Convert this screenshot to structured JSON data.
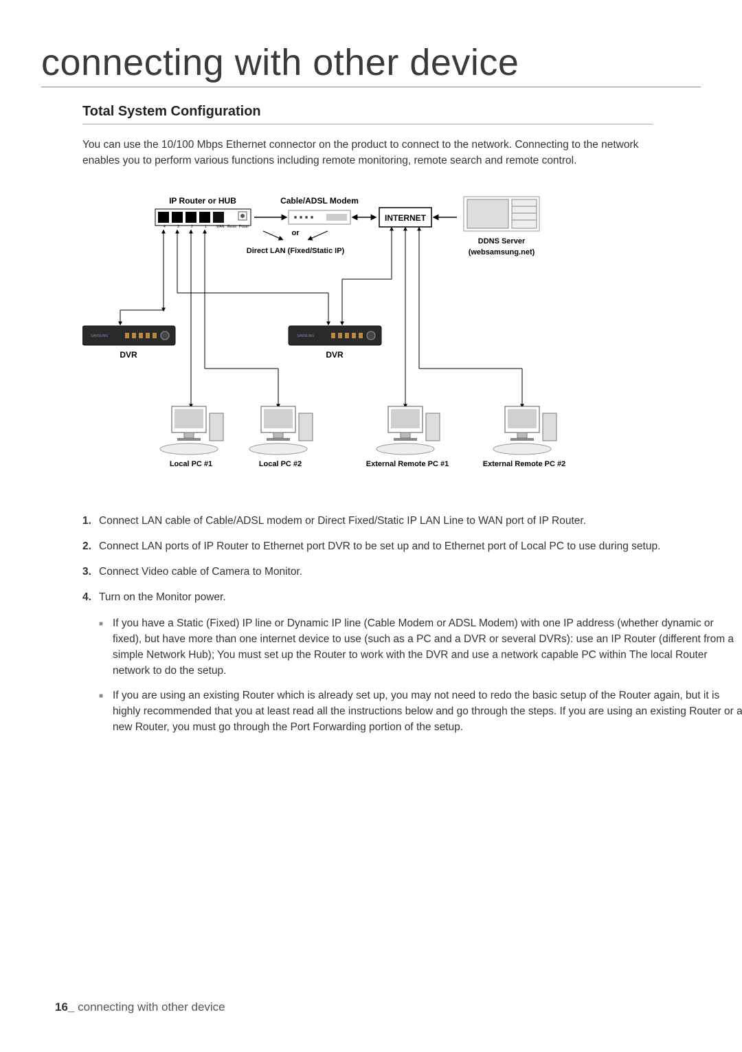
{
  "page_title": "connecting with other device",
  "section_title": "Total System Configuration",
  "intro_text": "You can use the 10/100 Mbps Ethernet connector on the product to connect to the network. Connecting to the network enables you to perform various functions including remote monitoring, remote search and remote control.",
  "diagram": {
    "ip_router": "IP Router or HUB",
    "modem": "Cable/ADSL Modem",
    "or": "or",
    "direct_lan": "Direct LAN (Fixed/Static IP)",
    "internet": "INTERNET",
    "ddns1": "DDNS Server",
    "ddns2": "(websamsung.net)",
    "dvr": "DVR",
    "local_pc1": "Local PC #1",
    "local_pc2": "Local PC #2",
    "ext_pc1": "External Remote PC #1",
    "ext_pc2": "External Remote PC #2",
    "router_ports": [
      "4",
      "3",
      "2",
      "1",
      "WAN",
      "Reset",
      "Power"
    ]
  },
  "steps": [
    {
      "num": "1.",
      "text": "Connect LAN cable of Cable/ADSL modem or Direct Fixed/Static IP LAN Line to WAN port of IP Router."
    },
    {
      "num": "2.",
      "text": "Connect LAN ports of IP Router to Ethernet port DVR to be set up and to Ethernet port of Local PC to use during setup."
    },
    {
      "num": "3.",
      "text": "Connect Video cable of Camera to Monitor."
    },
    {
      "num": "4.",
      "text": "Turn on the Monitor power."
    }
  ],
  "bullets": [
    "If you have a Static (Fixed) IP line or Dynamic IP line (Cable Modem or ADSL Modem) with one IP address (whether dynamic or fixed), but have more than one internet device to use (such as a PC and a DVR or several DVRs): use an IP Router (different from a simple Network Hub); You must set up the Router to work with the DVR and use a network capable PC within The local Router network to do the setup.",
    "If you are using an existing Router which is already set up, you may not need to redo the basic setup of the Router again, but it is highly recommended that you at least read all the instructions below and go through the steps. If you are using an existing Router or a new Router, you must go through the Port Forwarding portion of the setup."
  ],
  "footer": {
    "page_number": "16_",
    "footer_text": "connecting with other device"
  }
}
